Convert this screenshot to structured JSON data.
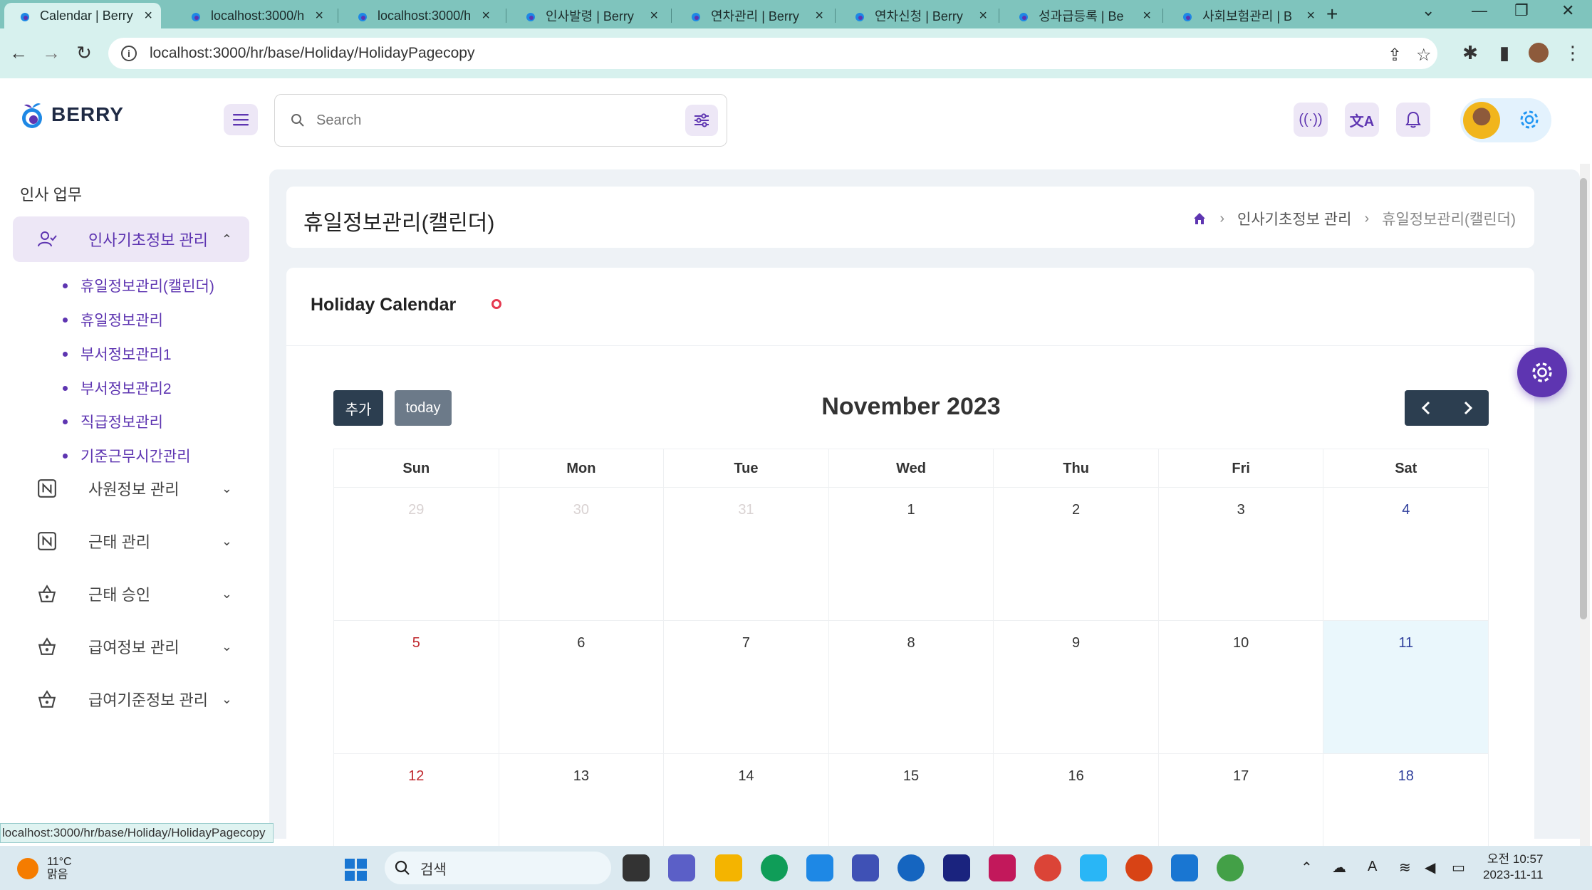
{
  "browser": {
    "tabs": [
      {
        "title": "Calendar | Berry",
        "active": true
      },
      {
        "title": "localhost:3000/h"
      },
      {
        "title": "localhost:3000/h"
      },
      {
        "title": "인사발령 | Berry"
      },
      {
        "title": "연차관리 | Berry"
      },
      {
        "title": "연차신청 | Berry"
      },
      {
        "title": "성과급등록 | Be"
      },
      {
        "title": "사회보험관리 | B"
      }
    ],
    "url": "localhost:3000/hr/base/Holiday/HolidayPagecopy",
    "status_url": "localhost:3000/hr/base/Holiday/HolidayPagecopy"
  },
  "header": {
    "brand": "BERRY",
    "search_placeholder": "Search"
  },
  "sidebar": {
    "section_title": "인사 업무",
    "active_group": "인사기초정보 관리",
    "sub_items": [
      "휴일정보관리(캘린더)",
      "휴일정보관리",
      "부서정보관리1",
      "부서정보관리2",
      "직급정보관리",
      "기준근무시간관리"
    ],
    "groups": [
      "사원정보 관리",
      "근태 관리",
      "근태 승인",
      "급여정보 관리",
      "급여기준정보 관리"
    ]
  },
  "page": {
    "title": "휴일정보관리(캘린더)",
    "breadcrumb": [
      "인사기초정보 관리",
      "휴일정보관리(캘린더)"
    ]
  },
  "calendar": {
    "card_title": "Holiday Calendar",
    "add_label": "추가",
    "today_label": "today",
    "month_title": "November 2023",
    "weekdays": [
      "Sun",
      "Mon",
      "Tue",
      "Wed",
      "Thu",
      "Fri",
      "Sat"
    ],
    "weeks": [
      [
        "29",
        "30",
        "31",
        "1",
        "2",
        "3",
        "4"
      ],
      [
        "5",
        "6",
        "7",
        "8",
        "9",
        "10",
        "11"
      ],
      [
        "12",
        "13",
        "14",
        "15",
        "16",
        "17",
        "18"
      ]
    ],
    "other_month_days": [
      "29",
      "30",
      "31"
    ],
    "today": "11"
  },
  "taskbar": {
    "temperature": "11°C",
    "weather": "맑음",
    "search_label": "검색",
    "time": "오전 10:57",
    "date": "2023-11-11"
  },
  "colors": {
    "accent": "#5e35b1",
    "accent_light": "#ede7f6",
    "calendar_button": "#2c3e50",
    "today_bg": "#eaf7fc"
  }
}
